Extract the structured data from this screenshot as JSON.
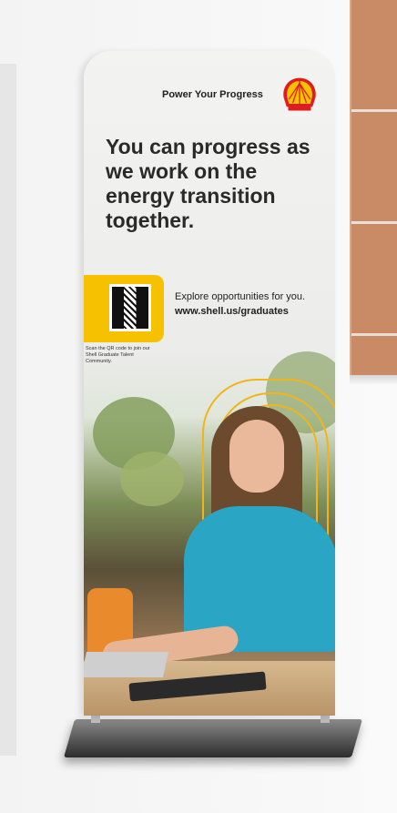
{
  "banner": {
    "tagline": "Power Your Progress",
    "headline": "You can progress as we work on the energy transition together.",
    "qr_note": "Scan the QR code to join our Shell Graduate Talent Community.",
    "explore": "Explore opportunities for you.",
    "url": "www.shell.us/graduates"
  },
  "colors": {
    "shell_yellow": "#f6c200",
    "shell_red": "#dd1d21",
    "top_color": "#2aa5c4"
  },
  "icons": [
    "shell-logo-icon",
    "qr-code-icon"
  ]
}
